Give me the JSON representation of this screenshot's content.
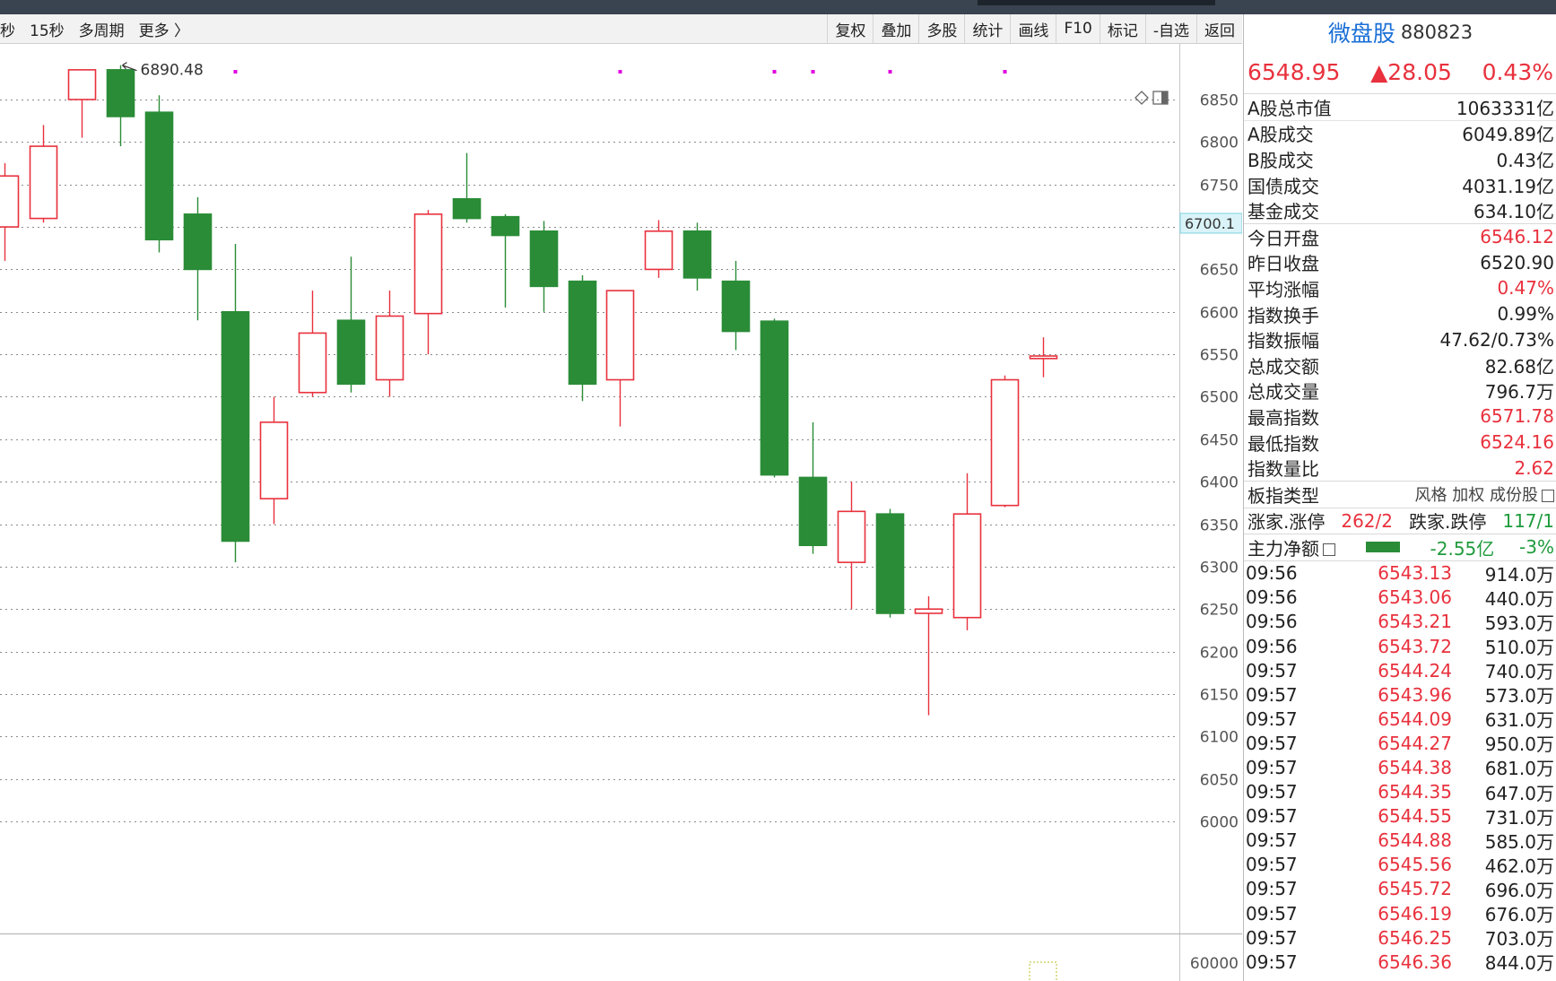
{
  "toolbar": {
    "left": [
      "秒",
      "15秒",
      "多周期",
      "更多 〉"
    ],
    "right": [
      "复权",
      "叠加",
      "多股",
      "统计",
      "画线",
      "F10",
      "标记",
      "-自选",
      "返回"
    ]
  },
  "price_scale": {
    "ticks": [
      "6850",
      "6800",
      "6750",
      "6700",
      "6650",
      "6600",
      "6550",
      "6500",
      "6450",
      "6400",
      "6350",
      "6300",
      "6250",
      "6200",
      "6150",
      "6100",
      "6050",
      "6000"
    ],
    "volume_tick": "60000",
    "cursor_label": "6700.1"
  },
  "chart_data": {
    "type": "candlestick",
    "max_label": "6890.48",
    "ylim": [
      6000,
      6850
    ],
    "colors": {
      "up": "#e8313d",
      "down": "#2a8c37",
      "grid": "#8a8a8a",
      "marker": "#e000e0"
    },
    "candles": [
      {
        "o": 6700,
        "h": 6775,
        "l": 6660,
        "c": 6760
      },
      {
        "o": 6710,
        "h": 6820,
        "l": 6705,
        "c": 6795
      },
      {
        "o": 6850,
        "h": 6865,
        "l": 6805,
        "c": 6885
      },
      {
        "o": 6885,
        "h": 6890.48,
        "l": 6795,
        "c": 6830
      },
      {
        "o": 6835,
        "h": 6855,
        "l": 6670,
        "c": 6685
      },
      {
        "o": 6715,
        "h": 6735,
        "l": 6590,
        "c": 6650
      },
      {
        "o": 6600,
        "h": 6680,
        "l": 6305,
        "c": 6330
      },
      {
        "o": 6380,
        "h": 6500,
        "l": 6350,
        "c": 6470
      },
      {
        "o": 6505,
        "h": 6625,
        "l": 6500,
        "c": 6575
      },
      {
        "o": 6590,
        "h": 6665,
        "l": 6505,
        "c": 6515
      },
      {
        "o": 6520,
        "h": 6625,
        "l": 6500,
        "c": 6595
      },
      {
        "o": 6598,
        "h": 6720,
        "l": 6550,
        "c": 6715
      },
      {
        "o": 6733,
        "h": 6787,
        "l": 6705,
        "c": 6710
      },
      {
        "o": 6712,
        "h": 6715,
        "l": 6605,
        "c": 6690
      },
      {
        "o": 6695,
        "h": 6707,
        "l": 6600,
        "c": 6630
      },
      {
        "o": 6636,
        "h": 6643,
        "l": 6495,
        "c": 6515
      },
      {
        "o": 6520,
        "h": 6625,
        "l": 6465,
        "c": 6625
      },
      {
        "o": 6650,
        "h": 6708,
        "l": 6640,
        "c": 6695
      },
      {
        "o": 6695,
        "h": 6705,
        "l": 6625,
        "c": 6640
      },
      {
        "o": 6636,
        "h": 6660,
        "l": 6555,
        "c": 6577
      },
      {
        "o": 6589,
        "h": 6592,
        "l": 6405,
        "c": 6408
      },
      {
        "o": 6405,
        "h": 6470,
        "l": 6315,
        "c": 6325
      },
      {
        "o": 6305,
        "h": 6400,
        "l": 6250,
        "c": 6365
      },
      {
        "o": 6362,
        "h": 6368,
        "l": 6240,
        "c": 6245
      },
      {
        "o": 6245,
        "h": 6265,
        "l": 6125,
        "c": 6250
      },
      {
        "o": 6240,
        "h": 6410,
        "l": 6225,
        "c": 6362
      },
      {
        "o": 6372,
        "h": 6525,
        "l": 6370,
        "c": 6520
      },
      {
        "o": 6545,
        "h": 6570,
        "l": 6523,
        "c": 6548
      }
    ],
    "marker_slots": [
      6,
      16,
      20,
      21,
      23,
      26
    ]
  },
  "sidebar": {
    "name": "微盘股",
    "code": "880823",
    "price": "6548.95",
    "change": "▲28.05",
    "pct": "0.43%",
    "total_mv": {
      "label": "A股总市值",
      "value": "1063331亿"
    },
    "turnover": [
      {
        "label": "A股成交",
        "value": "6049.89亿"
      },
      {
        "label": "B股成交",
        "value": "0.43亿"
      },
      {
        "label": "国债成交",
        "value": "4031.19亿"
      },
      {
        "label": "基金成交",
        "value": "634.10亿"
      }
    ],
    "stats": [
      {
        "label": "今日开盘",
        "value": "6546.12",
        "red": true
      },
      {
        "label": "昨日收盘",
        "value": "6520.90",
        "red": false
      },
      {
        "label": "平均涨幅",
        "value": "0.47%",
        "red": true
      },
      {
        "label": "指数换手",
        "value": "0.99%",
        "red": false
      },
      {
        "label": "指数振幅",
        "value": "47.62/0.73%",
        "red": false
      },
      {
        "label": "总成交额",
        "value": "82.68亿",
        "red": false
      },
      {
        "label": "总成交量",
        "value": "796.7万",
        "red": false
      },
      {
        "label": "最高指数",
        "value": "6571.78",
        "red": true
      },
      {
        "label": "最低指数",
        "value": "6524.16",
        "red": true
      },
      {
        "label": "指数量比",
        "value": "2.62",
        "red": true
      }
    ],
    "board_type": {
      "label": "板指类型",
      "value": "风格 加权 成份股"
    },
    "limits": {
      "up_label": "涨家.涨停",
      "up_value": "262/2",
      "down_label": "跌家.跌停",
      "down_value": "117/1"
    },
    "flow": {
      "label": "主力净额",
      "value": "-2.55亿",
      "pct": "-3%"
    },
    "ticks": [
      {
        "time": "09:56",
        "price": "6543.13",
        "vol": "914.0万"
      },
      {
        "time": "09:56",
        "price": "6543.06",
        "vol": "440.0万"
      },
      {
        "time": "09:56",
        "price": "6543.21",
        "vol": "593.0万"
      },
      {
        "time": "09:56",
        "price": "6543.72",
        "vol": "510.0万"
      },
      {
        "time": "09:57",
        "price": "6544.24",
        "vol": "740.0万"
      },
      {
        "time": "09:57",
        "price": "6543.96",
        "vol": "573.0万"
      },
      {
        "time": "09:57",
        "price": "6544.09",
        "vol": "631.0万"
      },
      {
        "time": "09:57",
        "price": "6544.27",
        "vol": "950.0万"
      },
      {
        "time": "09:57",
        "price": "6544.38",
        "vol": "681.0万"
      },
      {
        "time": "09:57",
        "price": "6544.35",
        "vol": "647.0万"
      },
      {
        "time": "09:57",
        "price": "6544.55",
        "vol": "731.0万"
      },
      {
        "time": "09:57",
        "price": "6544.88",
        "vol": "585.0万"
      },
      {
        "time": "09:57",
        "price": "6545.56",
        "vol": "462.0万"
      },
      {
        "time": "09:57",
        "price": "6545.72",
        "vol": "696.0万"
      },
      {
        "time": "09:57",
        "price": "6546.19",
        "vol": "676.0万"
      },
      {
        "time": "09:57",
        "price": "6546.25",
        "vol": "703.0万"
      },
      {
        "time": "09:57",
        "price": "6546.36",
        "vol": "844.0万"
      }
    ]
  }
}
